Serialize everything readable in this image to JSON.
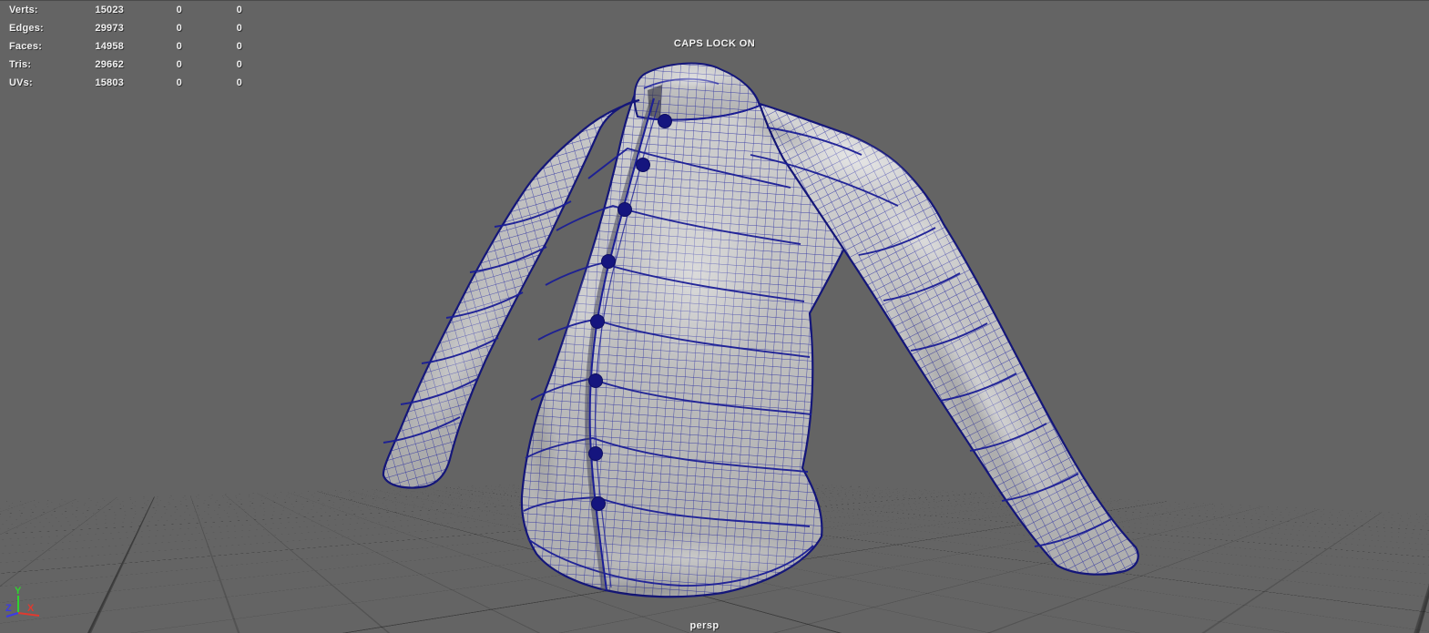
{
  "hud": {
    "rows": [
      {
        "label": "Verts:",
        "total": "15023",
        "col2": "0",
        "col3": "0"
      },
      {
        "label": "Edges:",
        "total": "29973",
        "col2": "0",
        "col3": "0"
      },
      {
        "label": "Faces:",
        "total": "14958",
        "col2": "0",
        "col3": "0"
      },
      {
        "label": "Tris:",
        "total": "29662",
        "col2": "0",
        "col3": "0"
      },
      {
        "label": "UVs:",
        "total": "15803",
        "col2": "0",
        "col3": "0"
      }
    ]
  },
  "viewport": {
    "caps_lock_warning": "CAPS LOCK ON",
    "camera_label": "persp",
    "background_color": "#646464",
    "grid_line_color": "#555555"
  },
  "axis_gizmo": {
    "x_label": "X",
    "y_label": "Y",
    "z_label": "Z",
    "x_color": "#e03a2f",
    "y_color": "#2fd32f",
    "z_color": "#3a3ae8"
  },
  "model": {
    "description": "quilted puffer jacket displayed as shaded mesh with wireframe",
    "wireframe_color": "#1d209e",
    "surface_color": "#c6c6c6",
    "button_count": "8"
  }
}
